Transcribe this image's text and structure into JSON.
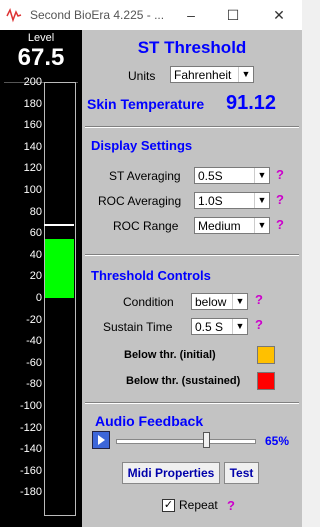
{
  "window": {
    "title": "Second BioEra 4.225 - ...",
    "minimize_icon": "minimize-icon",
    "maximize_icon": "maximize-icon",
    "close_icon": "close-icon"
  },
  "meter": {
    "label": "Level",
    "value": "67.5",
    "ticks": [
      "200",
      "180",
      "160",
      "140",
      "120",
      "100",
      "80",
      "60",
      "40",
      "20",
      "0",
      "-20",
      "-40",
      "-60",
      "-80",
      "-100",
      "-120",
      "-140",
      "-160",
      "-180"
    ],
    "scale_min": -200,
    "scale_max": 200,
    "bar_from": 0,
    "bar_to": 55,
    "threshold": 68,
    "bar_color": "#00ff00"
  },
  "st": {
    "title": "ST Threshold",
    "units_label": "Units",
    "units_value": "Fahrenheit",
    "skin_label": "Skin Temperature",
    "skin_value": "91.12"
  },
  "display": {
    "title": "Display Settings",
    "averaging_label": "ST Averaging",
    "averaging_value": "0.5S",
    "roc_averaging_label": "ROC Averaging",
    "roc_averaging_value": "1.0S",
    "roc_range_label": "ROC Range",
    "roc_range_value": "Medium",
    "help": "?"
  },
  "threshold": {
    "title": "Threshold Controls",
    "condition_label": "Condition",
    "condition_value": "below",
    "sustain_label": "Sustain Time",
    "sustain_value": "0.5 S",
    "below_initial_label": "Below thr. (initial)",
    "below_initial_color": "#ffc000",
    "below_sustained_label": "Below thr. (sustained)",
    "below_sustained_color": "#ff0000"
  },
  "audio": {
    "title": "Audio Feedback",
    "volume": "65%",
    "volume_fraction": 0.65,
    "midi_button": "Midi Properties",
    "test_button": "Test",
    "repeat_label": "Repeat",
    "repeat_checked": true
  }
}
